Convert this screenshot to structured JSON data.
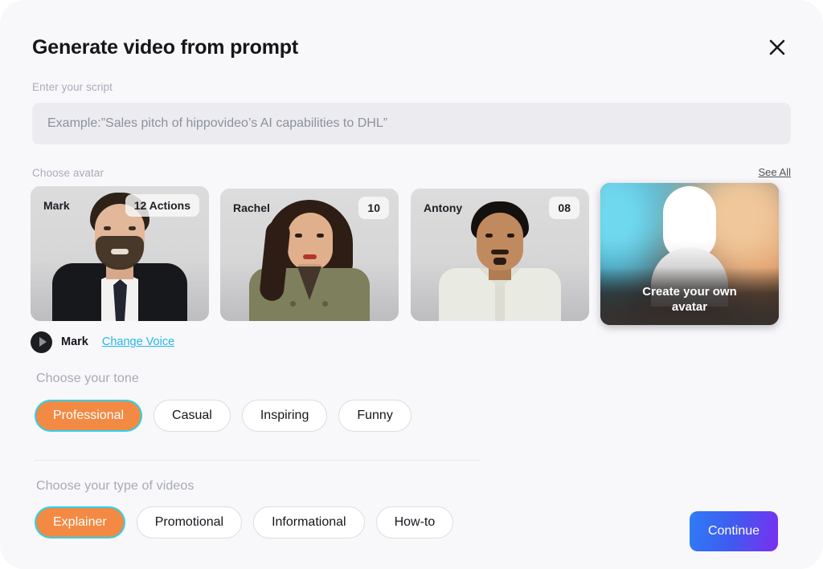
{
  "modal": {
    "title": "Generate video from prompt",
    "close_icon": "close-icon"
  },
  "script": {
    "label": "Enter your script",
    "value": "",
    "placeholder": "Example:”Sales pitch of hippovideo’s AI capabilities to DHL”"
  },
  "avatars": {
    "label": "Choose avatar",
    "see_all": "See All",
    "items": [
      {
        "name": "Mark",
        "badge": "12 Actions"
      },
      {
        "name": "Rachel",
        "badge": "10"
      },
      {
        "name": "Antony",
        "badge": "08"
      }
    ],
    "create_own": {
      "line1": "Create your own",
      "line2": "avatar"
    }
  },
  "voice": {
    "play_icon": "play-icon",
    "name": "Mark",
    "change_link": "Change Voice"
  },
  "tone": {
    "label": "Choose your tone",
    "options": [
      "Professional",
      "Casual",
      "Inspiring",
      "Funny"
    ],
    "selected": "Professional"
  },
  "video_type": {
    "label": "Choose your type of videos",
    "options": [
      "Explainer",
      "Promotional",
      "Informational",
      "How-to"
    ],
    "selected": "Explainer"
  },
  "footer": {
    "continue_label": "Continue"
  },
  "colors": {
    "accent_orange": "#f38a43",
    "select_ring_cyan": "#2fd0ef",
    "link_cyan": "#25b7e8",
    "continue_gradient_start": "#2e7df6",
    "continue_gradient_end": "#7a2ff0",
    "modal_bg": "#f8f8fb"
  }
}
